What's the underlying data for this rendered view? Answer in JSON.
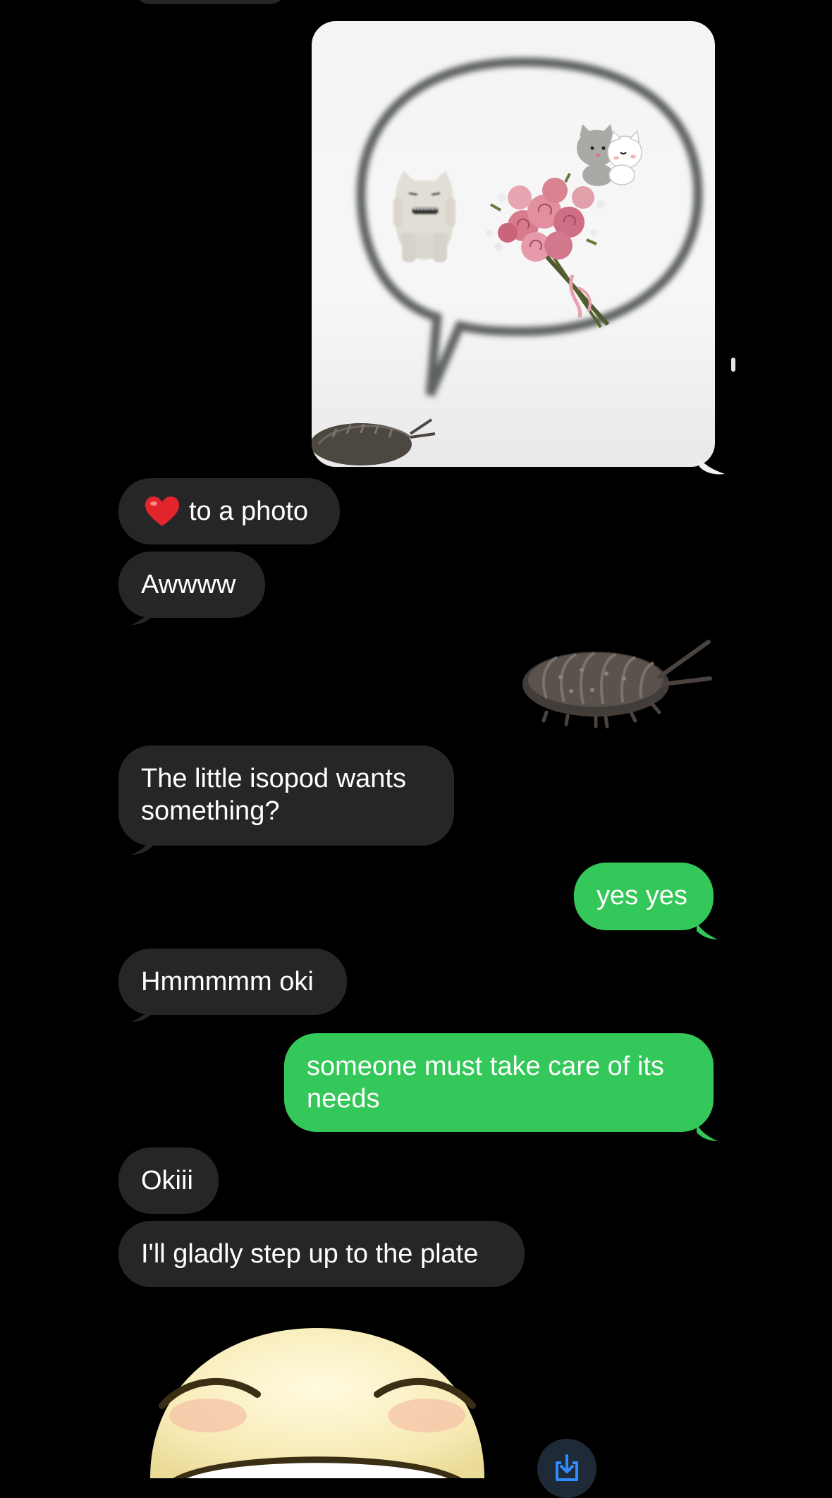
{
  "messages": [
    {
      "id": "m1",
      "side": "in",
      "text": "to a photo",
      "reaction": "heart-emoji"
    },
    {
      "id": "m2",
      "side": "in",
      "text": "Awwww"
    },
    {
      "id": "m3",
      "side": "in",
      "text": "The little isopod wants something?"
    },
    {
      "id": "m4",
      "side": "out",
      "text": "yes yes"
    },
    {
      "id": "m5",
      "side": "in",
      "text": "Hmmmmm oki"
    },
    {
      "id": "m6",
      "side": "out",
      "text": "someone must take care of its needs"
    },
    {
      "id": "m7",
      "side": "in",
      "text": "Okiii"
    },
    {
      "id": "m8",
      "side": "in",
      "text": "I'll gladly step up to the plate"
    }
  ],
  "stickers": [
    "isopod-sticker",
    "grinning-face-sticker"
  ],
  "photo": {
    "contents": [
      "speech-bubble-outline",
      "cats-hugging-sticker",
      "monster-plush",
      "rose-bouquet",
      "isopod"
    ]
  },
  "colors": {
    "background": "#000000",
    "incoming": "#262629",
    "outgoing": "#34c759",
    "text": "#ffffff"
  },
  "icons": {
    "download": "download-icon",
    "heart": "heart-emoji"
  }
}
